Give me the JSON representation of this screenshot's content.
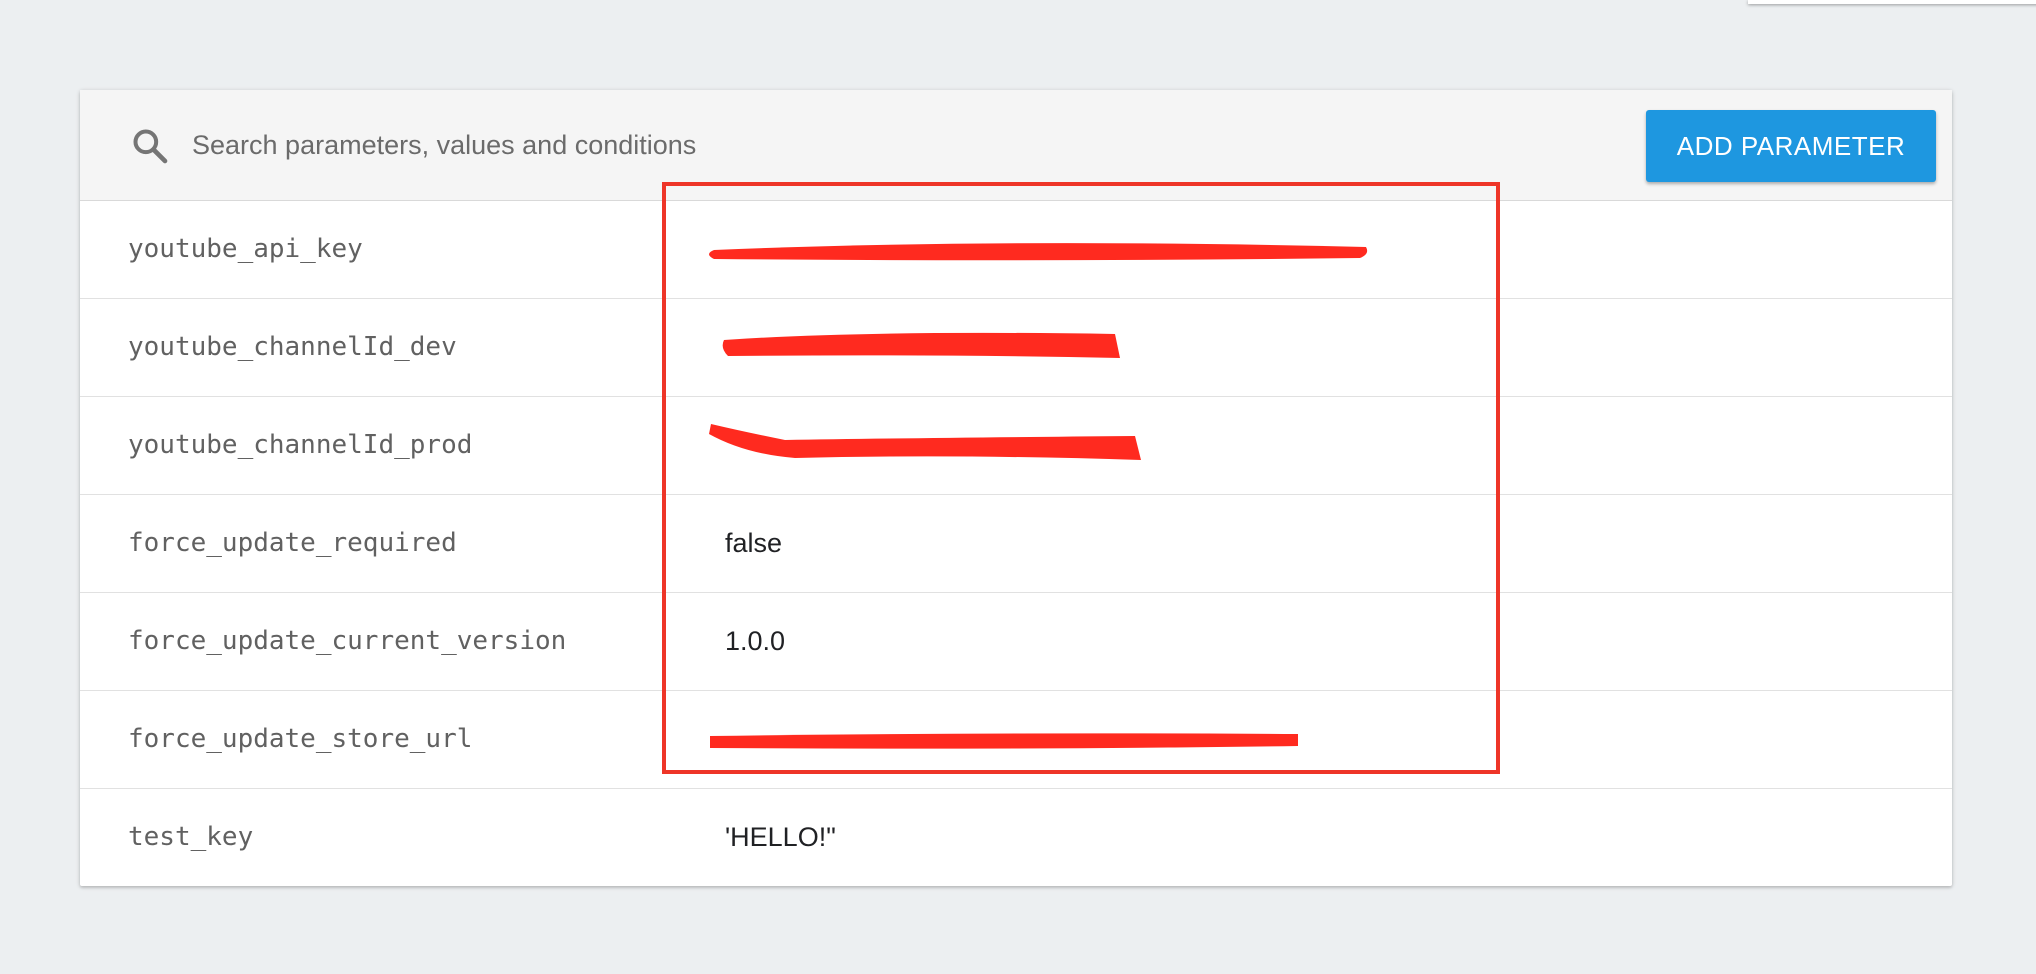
{
  "toolbar": {
    "search_placeholder": "Search parameters, values and conditions",
    "add_parameter_label": "ADD PARAMETER"
  },
  "parameters": [
    {
      "key": "youtube_api_key",
      "value": "",
      "redacted": true
    },
    {
      "key": "youtube_channelId_dev",
      "value": "",
      "redacted": true
    },
    {
      "key": "youtube_channelId_prod",
      "value": "",
      "redacted": true
    },
    {
      "key": "force_update_required",
      "value": "false",
      "redacted": false
    },
    {
      "key": "force_update_current_version",
      "value": "1.0.0",
      "redacted": false
    },
    {
      "key": "force_update_store_url",
      "value": "",
      "redacted": true
    },
    {
      "key": "test_key",
      "value": "'HELLO!\"",
      "redacted": false
    }
  ],
  "colors": {
    "accent_button": "#1e97e0",
    "annotation_red": "#ee3528",
    "redaction_red": "#ff2a1f",
    "page_background": "#eceff1"
  },
  "icons": {
    "search": "search-icon"
  }
}
